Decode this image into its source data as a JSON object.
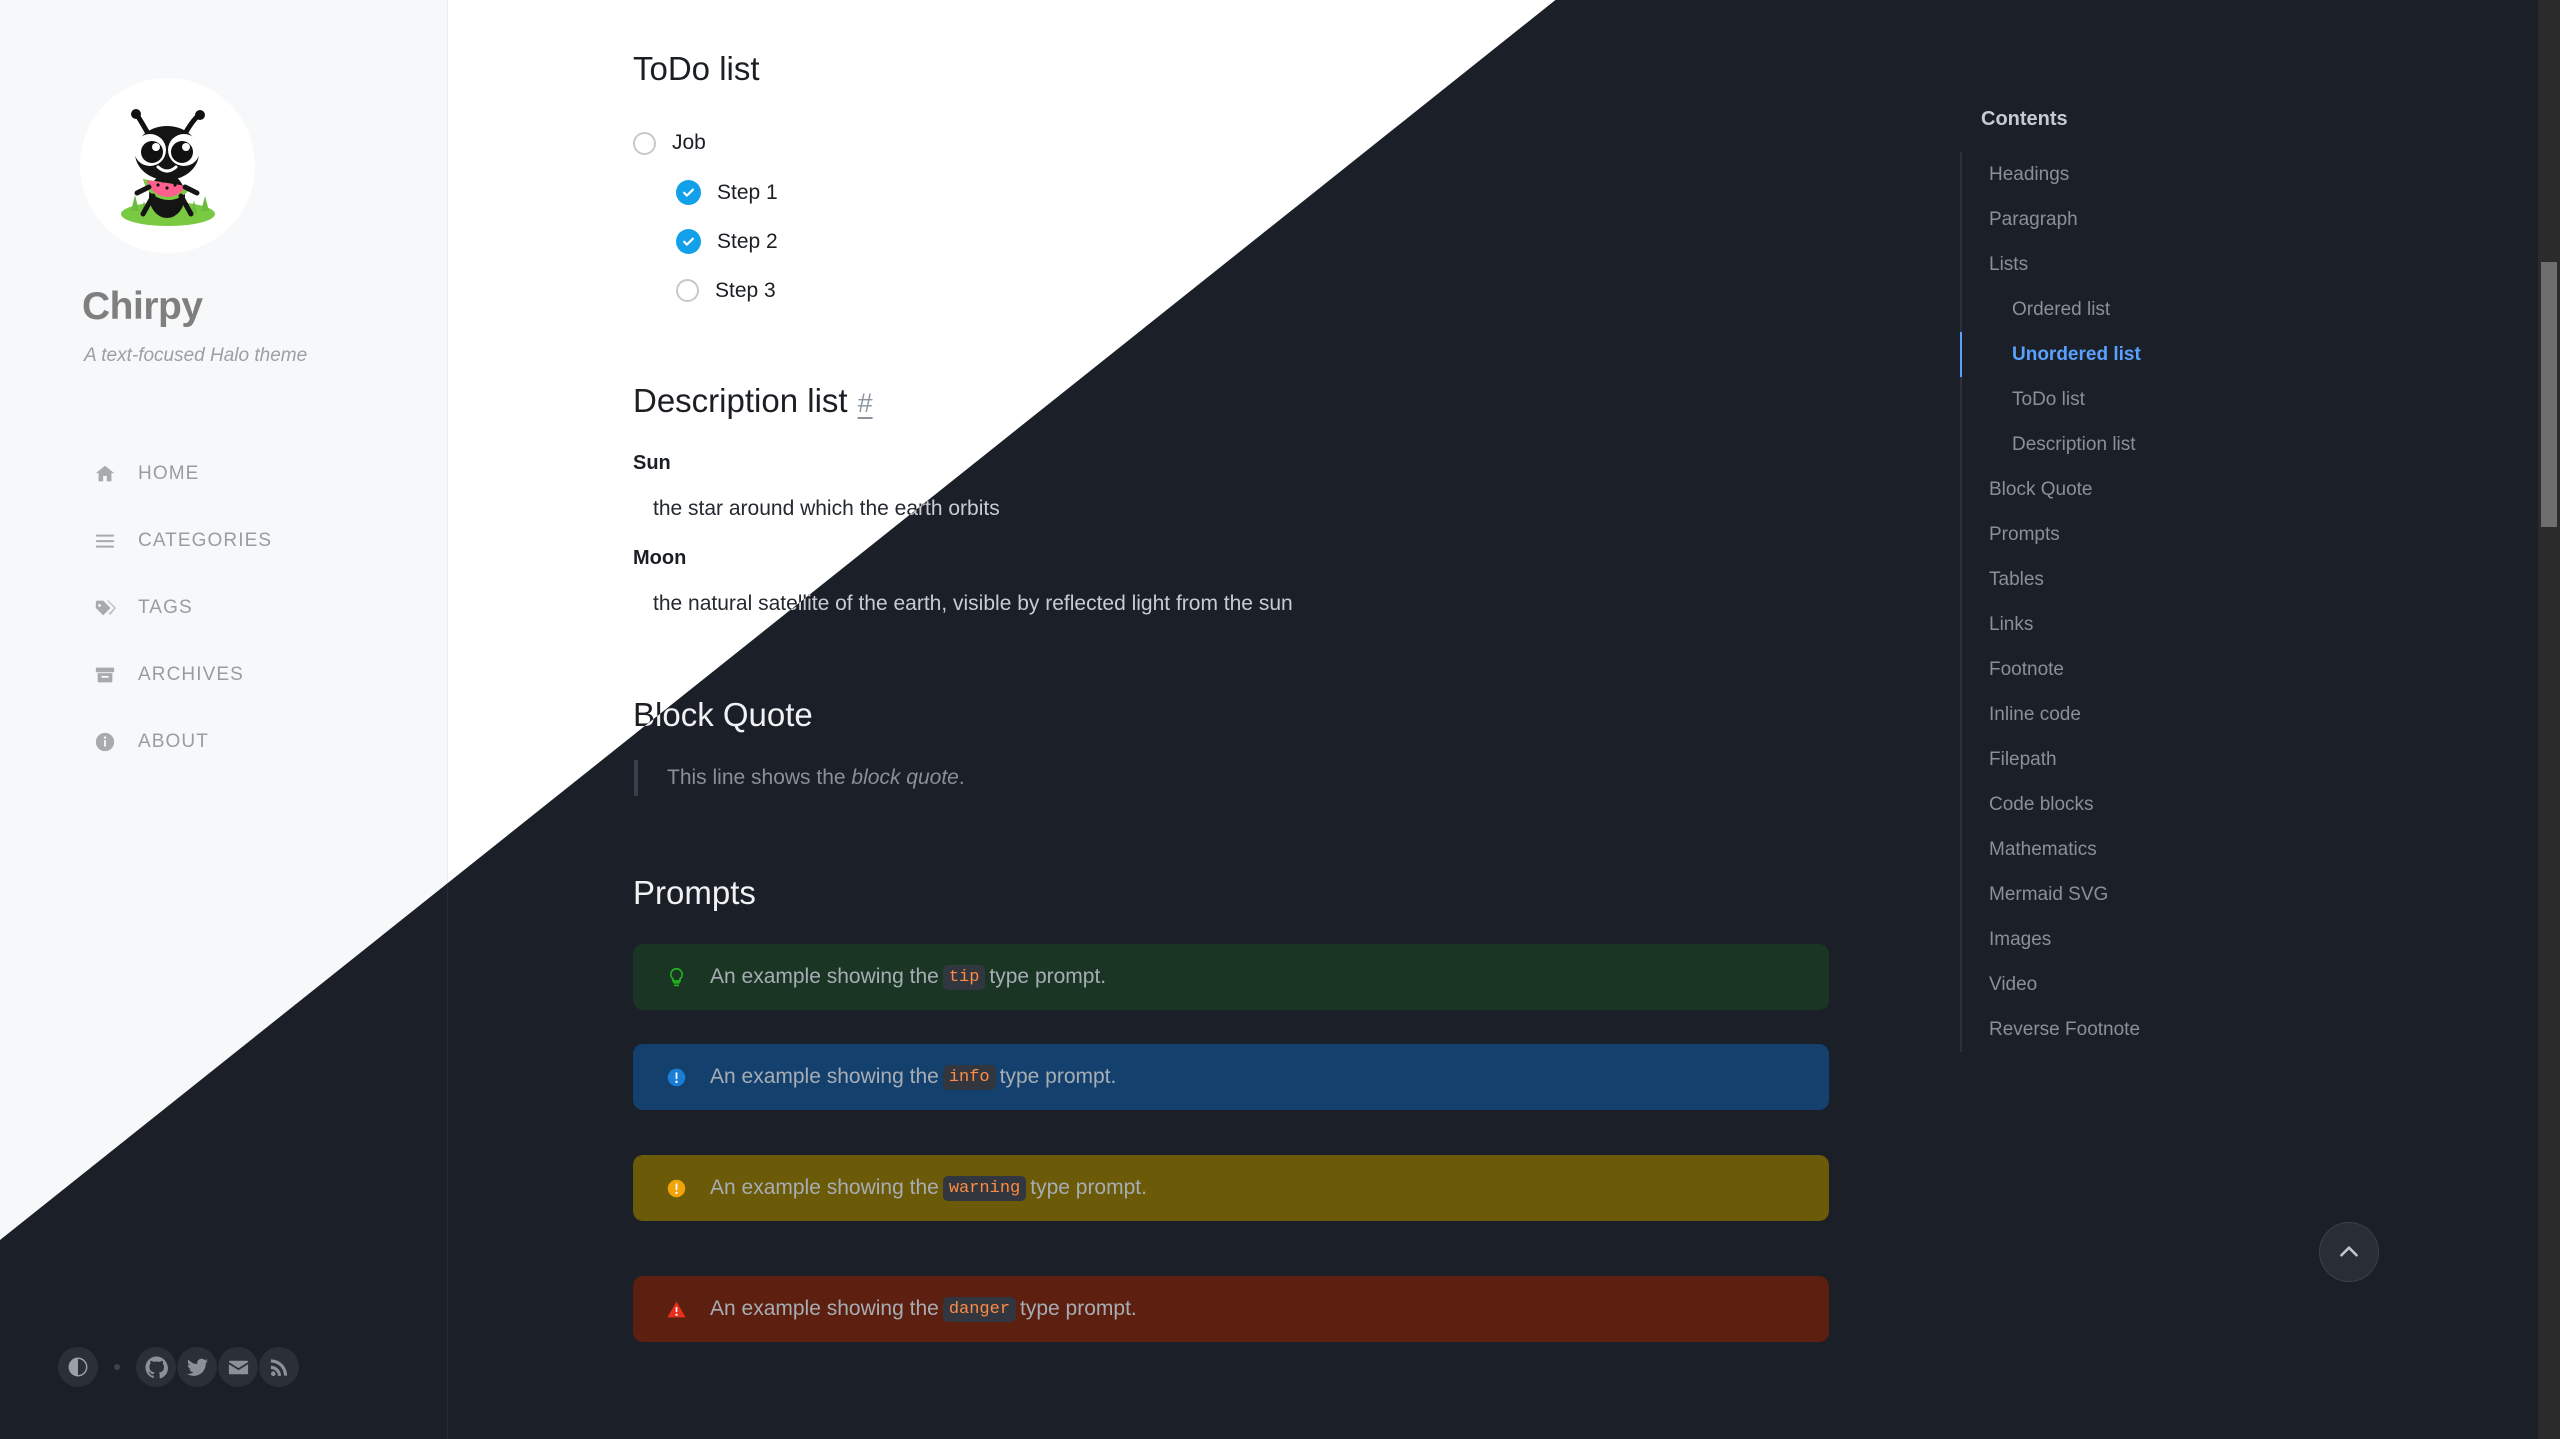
{
  "sidebar": {
    "site_title": "Chirpy",
    "site_subtitle": "A text-focused Halo theme",
    "avatar_alt": "chirpy-ant-avatar",
    "nav": [
      {
        "label": "HOME",
        "icon": "home-icon"
      },
      {
        "label": "CATEGORIES",
        "icon": "list-icon"
      },
      {
        "label": "TAGS",
        "icon": "tag-icon"
      },
      {
        "label": "ARCHIVES",
        "icon": "archive-icon"
      },
      {
        "label": "ABOUT",
        "icon": "info-icon"
      }
    ],
    "bottom": {
      "mode_toggle": "theme-mode-toggle",
      "socials": [
        {
          "name": "github-icon"
        },
        {
          "name": "twitter-icon"
        },
        {
          "name": "email-icon"
        },
        {
          "name": "rss-icon"
        }
      ]
    }
  },
  "main": {
    "todo": {
      "heading": "ToDo list",
      "items": [
        {
          "label": "Job",
          "checked": false,
          "indent": false
        },
        {
          "label": "Step 1",
          "checked": true,
          "indent": true
        },
        {
          "label": "Step 2",
          "checked": true,
          "indent": true
        },
        {
          "label": "Step 3",
          "checked": false,
          "indent": true
        }
      ]
    },
    "description_list": {
      "heading": "Description list",
      "anchor": "#",
      "entries": [
        {
          "term": "Sun",
          "definition": "the star around which the earth orbits"
        },
        {
          "term": "Moon",
          "definition": "the natural satellite of the earth, visible by reflected light from the sun"
        }
      ]
    },
    "block_quote": {
      "heading": "Block Quote",
      "text_before": "This line shows the ",
      "text_italic": "block quote",
      "text_after": "."
    },
    "prompts": {
      "heading": "Prompts",
      "items": [
        {
          "type": "tip",
          "icon": "lightbulb-icon",
          "before": "An example showing the ",
          "code": "tip",
          "after": " type prompt."
        },
        {
          "type": "info",
          "icon": "info-circle-icon",
          "before": "An example showing the ",
          "code": "info",
          "after": " type prompt."
        },
        {
          "type": "warning",
          "icon": "warning-circle-icon",
          "before": "An example showing the ",
          "code": "warning",
          "after": " type prompt."
        },
        {
          "type": "danger",
          "icon": "danger-triangle-icon",
          "before": "An example showing the ",
          "code": "danger",
          "after": " type prompt."
        }
      ]
    }
  },
  "toc": {
    "title": "Contents",
    "items": [
      {
        "label": "Headings",
        "level": 1,
        "active": false
      },
      {
        "label": "Paragraph",
        "level": 1,
        "active": false
      },
      {
        "label": "Lists",
        "level": 1,
        "active": false
      },
      {
        "label": "Ordered list",
        "level": 2,
        "active": false
      },
      {
        "label": "Unordered list",
        "level": 2,
        "active": true
      },
      {
        "label": "ToDo list",
        "level": 2,
        "active": false
      },
      {
        "label": "Description list",
        "level": 2,
        "active": false
      },
      {
        "label": "Block Quote",
        "level": 1,
        "active": false
      },
      {
        "label": "Prompts",
        "level": 1,
        "active": false
      },
      {
        "label": "Tables",
        "level": 1,
        "active": false
      },
      {
        "label": "Links",
        "level": 1,
        "active": false
      },
      {
        "label": "Footnote",
        "level": 1,
        "active": false
      },
      {
        "label": "Inline code",
        "level": 1,
        "active": false
      },
      {
        "label": "Filepath",
        "level": 1,
        "active": false
      },
      {
        "label": "Code blocks",
        "level": 1,
        "active": false
      },
      {
        "label": "Mathematics",
        "level": 1,
        "active": false
      },
      {
        "label": "Mermaid SVG",
        "level": 1,
        "active": false
      },
      {
        "label": "Images",
        "level": 1,
        "active": false
      },
      {
        "label": "Video",
        "level": 1,
        "active": false
      },
      {
        "label": "Reverse Footnote",
        "level": 1,
        "active": false
      }
    ]
  },
  "back_to_top": {
    "icon": "chevron-up-icon",
    "label": "Back to top"
  },
  "colors": {
    "accent_blue": "#13a0eb",
    "toc_active": "#5aa1ff",
    "code_orange": "#e8590c",
    "tip_green": "#2ea043",
    "info_blue": "#1a7fd4",
    "warning_amber": "#f0a30a",
    "danger_red": "#e5301c",
    "light_bg": "#ffffff",
    "light_sidebar": "#f6f8fa",
    "dark_bg": "#1b1f27"
  }
}
